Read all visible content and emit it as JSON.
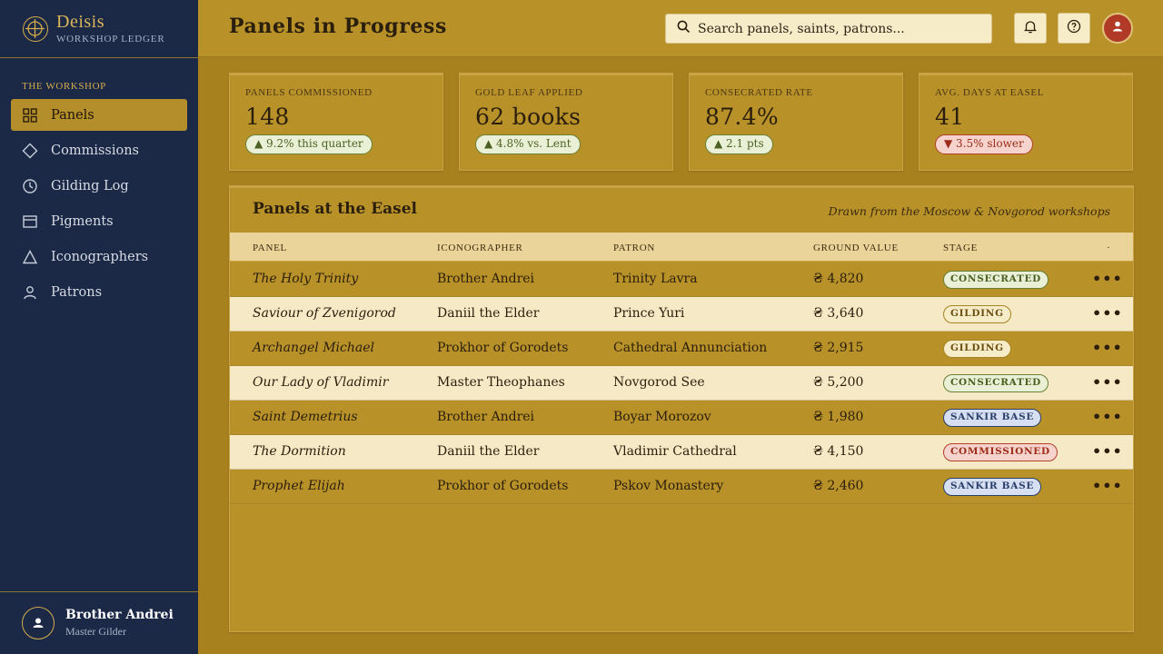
{
  "brand": {
    "name": "Deisis",
    "subtitle": "WORKSHOP LEDGER"
  },
  "sidebar": {
    "section": "THE WORKSHOP",
    "items": [
      {
        "label": "Panels",
        "icon": "grid-icon",
        "active": true
      },
      {
        "label": "Commissions",
        "icon": "diamond-icon"
      },
      {
        "label": "Gilding Log",
        "icon": "clock-icon"
      },
      {
        "label": "Pigments",
        "icon": "palette-box-icon"
      },
      {
        "label": "Iconographers",
        "icon": "triangle-icon"
      },
      {
        "label": "Patrons",
        "icon": "person-icon"
      }
    ],
    "user": {
      "name": "Brother Andrei",
      "role": "Master Gilder"
    }
  },
  "header": {
    "title": "Panels in Progress",
    "search_placeholder": "Search panels, saints, patrons..."
  },
  "stats": [
    {
      "label": "PANELS COMMISSIONED",
      "value": "148",
      "delta": "▲ 9.2% this quarter",
      "trend": "up"
    },
    {
      "label": "GOLD LEAF APPLIED",
      "value": "62 books",
      "delta": "▲ 4.8% vs. Lent",
      "trend": "up"
    },
    {
      "label": "CONSECRATED RATE",
      "value": "87.4%",
      "delta": "▲ 2.1 pts",
      "trend": "up"
    },
    {
      "label": "AVG. DAYS AT EASEL",
      "value": "41",
      "delta": "▼ 3.5% slower",
      "trend": "down"
    }
  ],
  "table": {
    "title": "Panels at the Easel",
    "note": "Drawn from the Moscow & Novgorod workshops",
    "columns": [
      "PANEL",
      "ICONOGRAPHER",
      "PATRON",
      "GROUND VALUE",
      "STAGE",
      "·"
    ],
    "rows": [
      {
        "panel": "The Holy Trinity",
        "iconographer": "Brother Andrei",
        "patron": "Trinity Lavra",
        "value": "₴ 4,820",
        "stage": "CONSECRATED",
        "stage_kind": "consecrated"
      },
      {
        "panel": "Saviour of Zvenigorod",
        "iconographer": "Daniil the Elder",
        "patron": "Prince Yuri",
        "value": "₴ 3,640",
        "stage": "GILDING",
        "stage_kind": "gilding"
      },
      {
        "panel": "Archangel Michael",
        "iconographer": "Prokhor of Gorodets",
        "patron": "Cathedral Annunciation",
        "value": "₴ 2,915",
        "stage": "GILDING",
        "stage_kind": "gilding"
      },
      {
        "panel": "Our Lady of Vladimir",
        "iconographer": "Master Theophanes",
        "patron": "Novgorod See",
        "value": "₴ 5,200",
        "stage": "CONSECRATED",
        "stage_kind": "consecrated"
      },
      {
        "panel": "Saint Demetrius",
        "iconographer": "Brother Andrei",
        "patron": "Boyar Morozov",
        "value": "₴ 1,980",
        "stage": "SANKIR BASE",
        "stage_kind": "sankir"
      },
      {
        "panel": "The Dormition",
        "iconographer": "Daniil the Elder",
        "patron": "Vladimir Cathedral",
        "value": "₴ 4,150",
        "stage": "COMMISSIONED",
        "stage_kind": "commissioned"
      },
      {
        "panel": "Prophet Elijah",
        "iconographer": "Prokhor of Gorodets",
        "patron": "Pskov Monastery",
        "value": "₴ 2,460",
        "stage": "SANKIR BASE",
        "stage_kind": "sankir"
      }
    ],
    "row_action": "•••"
  },
  "colors": {
    "sidebar": "#1b2846",
    "gold": "#b89129",
    "accent": "#d4ad4c",
    "avatar": "#b03a26"
  }
}
